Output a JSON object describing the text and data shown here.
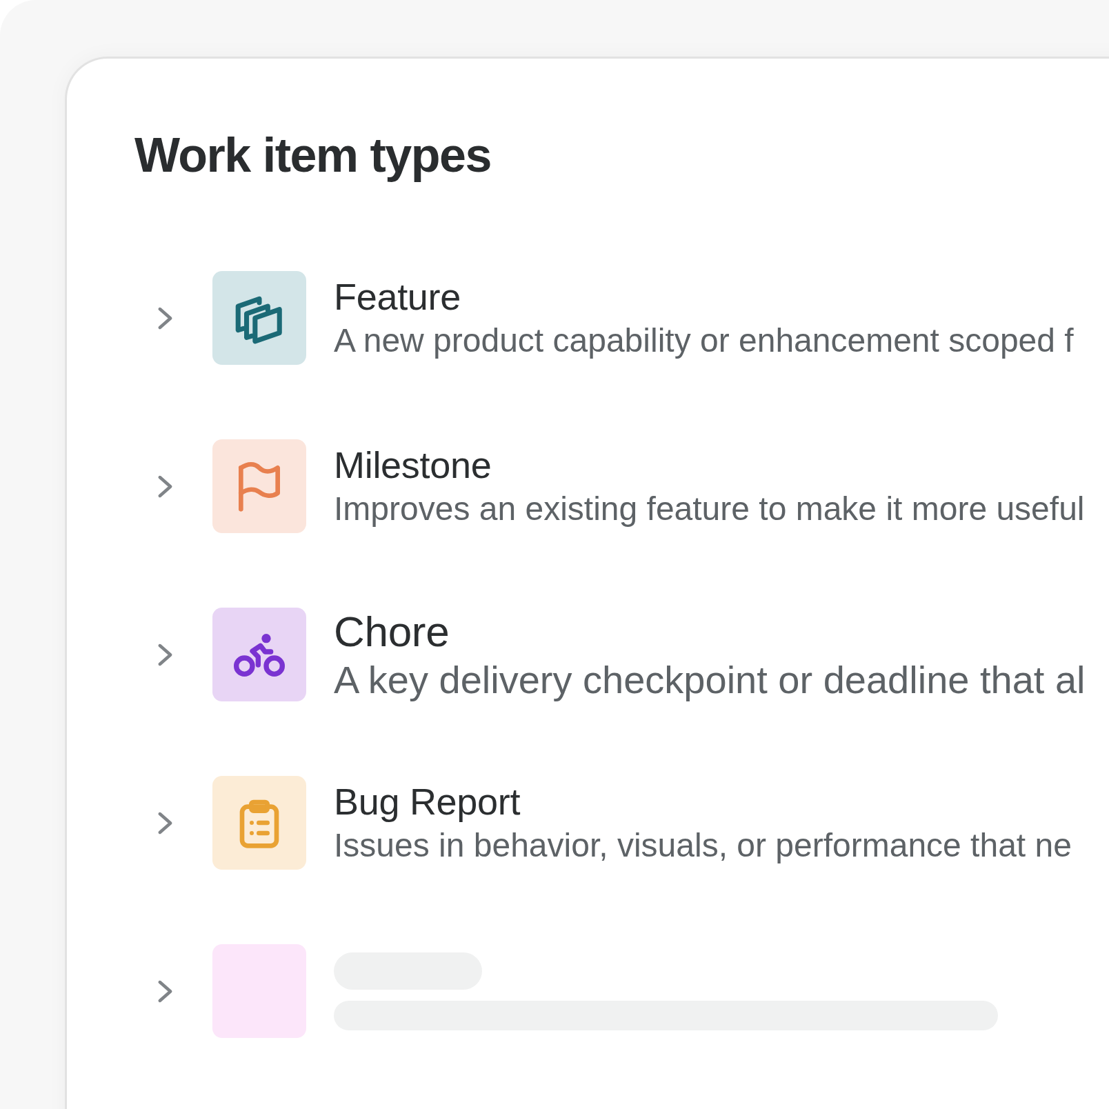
{
  "title": "Work item types",
  "items": [
    {
      "kind": "feature",
      "color": "#d3e5e8",
      "expanded": false,
      "selected": false,
      "name": "Feature",
      "description": "A new product capability or enhancement scoped f"
    },
    {
      "kind": "milestone",
      "color": "#fbe5dc",
      "expanded": false,
      "selected": false,
      "name": "Milestone",
      "description": "Improves an existing feature to make it more useful"
    },
    {
      "kind": "chore",
      "color": "#e8d5f5",
      "expanded": false,
      "selected": true,
      "name": "Chore",
      "description": "A key delivery checkpoint or deadline that al"
    },
    {
      "kind": "bug",
      "color": "#fcecd6",
      "expanded": false,
      "selected": false,
      "name": "Bug Report",
      "description": "Issues in behavior, visuals, or performance that ne"
    },
    {
      "kind": "placeholder",
      "color": "#fce6fa",
      "expanded": false,
      "selected": false
    }
  ]
}
